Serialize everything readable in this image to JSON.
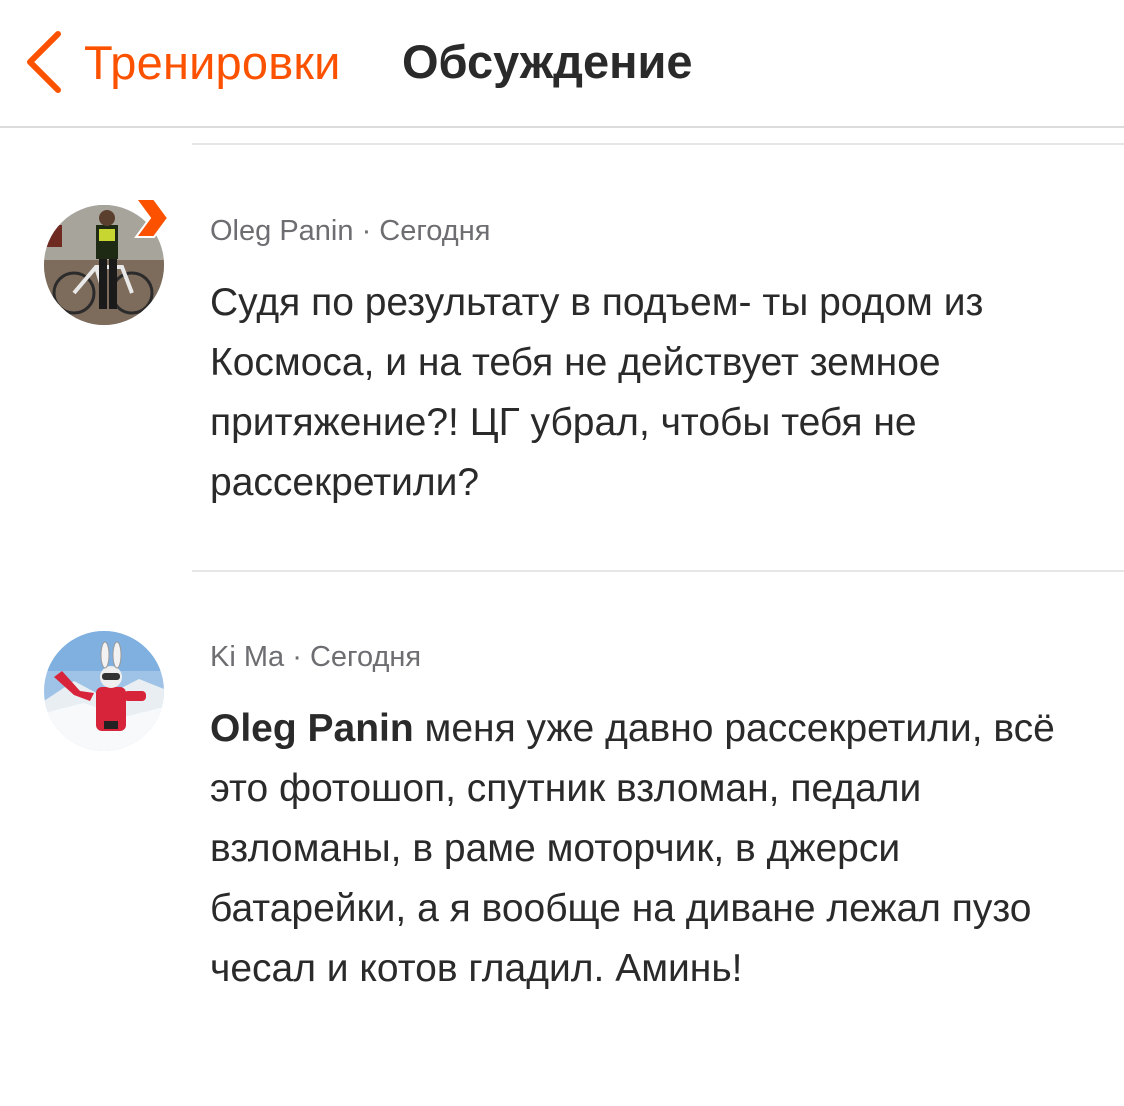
{
  "nav": {
    "back_label": "Тренировки",
    "title": "Обсуждение",
    "accent_color": "#fc5200"
  },
  "comments": [
    {
      "author": "Oleg Panin",
      "separator": "·",
      "time": "Сегодня",
      "avatar_icon": "cyclist-photo-avatar",
      "badge_icon": "subscriber-badge-icon",
      "text": "Судя по результату в подъем- ты родом из Космоса, и на тебя не действует земное притяжение?! ЦГ убрал, чтобы тебя не рассекретили?"
    },
    {
      "author": "Ki Ma",
      "separator": "·",
      "time": "Сегодня",
      "avatar_icon": "skier-photo-avatar",
      "mention": "Oleg Panin",
      "text": " меня уже давно рассекретили, всё это фотошоп, спутник взломан, педали взломаны, в раме моторчик, в джерси батарейки, а я вообще на диване лежал пузо чесал и котов гладил. Аминь!"
    }
  ]
}
